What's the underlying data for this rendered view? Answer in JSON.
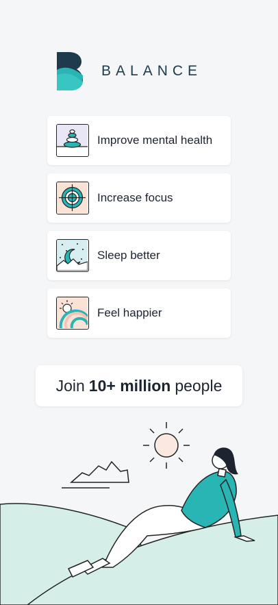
{
  "brand": {
    "name": "BALANCE",
    "colors": {
      "teal": "#2ab5b5",
      "navy": "#1f3a4b",
      "mint": "#d5efe8"
    }
  },
  "features": [
    {
      "label": "Improve mental health",
      "icon": "stacked-stones-icon"
    },
    {
      "label": "Increase focus",
      "icon": "target-icon"
    },
    {
      "label": "Sleep better",
      "icon": "moon-night-icon"
    },
    {
      "label": "Feel happier",
      "icon": "sun-rainbow-icon"
    }
  ],
  "social_proof": {
    "prefix": "Join",
    "highlight": "10+ million",
    "suffix": "people"
  }
}
